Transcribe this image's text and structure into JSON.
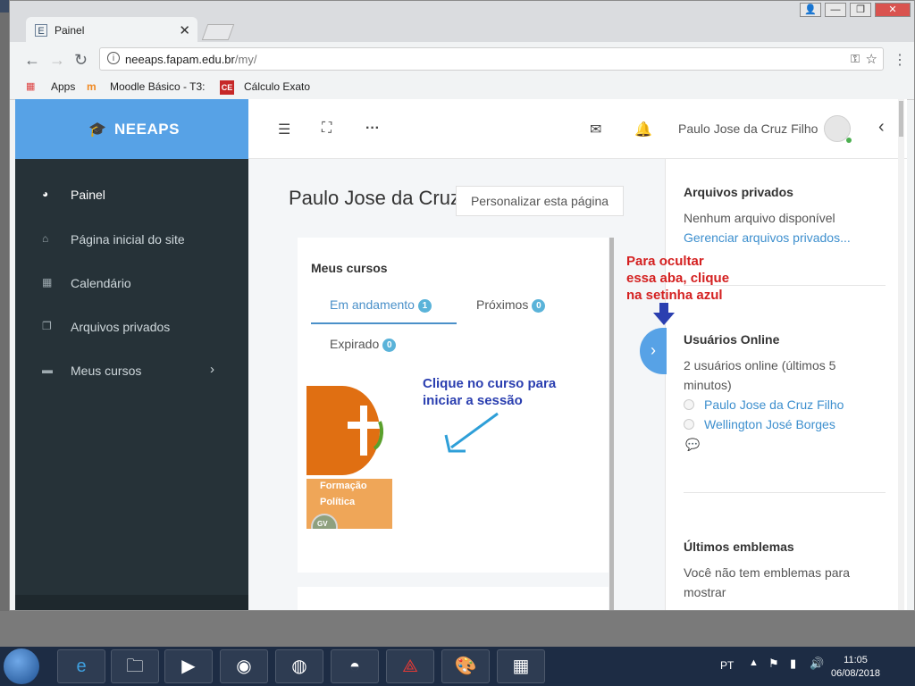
{
  "browser": {
    "tab_title": "Painel",
    "tab_favicon": "E",
    "url_host": "neeaps.fapam.edu.br",
    "url_path": "/my/",
    "bookmarks": [
      {
        "label": "Apps"
      },
      {
        "label": "Moodle Básico - T3:"
      },
      {
        "label": "Cálculo Exato"
      }
    ],
    "bookmark_ce_icon": "CE"
  },
  "site": {
    "brand": "NEEAPS",
    "sidebar": [
      {
        "label": "Painel",
        "icon": "dashboard-icon"
      },
      {
        "label": "Página inicial do site",
        "icon": "home-icon"
      },
      {
        "label": "Calendário",
        "icon": "calendar-icon"
      },
      {
        "label": "Arquivos privados",
        "icon": "files-icon"
      },
      {
        "label": "Meus cursos",
        "icon": "archive-icon"
      }
    ],
    "user_name": "Paulo Jose da Cruz Filho"
  },
  "main": {
    "page_title": "Paulo Jose da Cruz",
    "customize_button": "Personalizar esta página",
    "courses": {
      "title": "Meus cursos",
      "tabs": [
        {
          "label": "Em andamento",
          "count": "1"
        },
        {
          "label": "Próximos",
          "count": "0"
        },
        {
          "label": "Expirado",
          "count": "0"
        }
      ],
      "course_name_line1": "Formação",
      "course_name_line2": "Política",
      "course_badge": "GV"
    },
    "hint_course_line1": "Clique no curso para",
    "hint_course_line2": "iniciar a sessão",
    "hint_hide_line1": "Para ocultar",
    "hint_hide_line2": "essa aba, clique",
    "hint_hide_line3": "na setinha azul"
  },
  "drawer": {
    "private_files_title": "Arquivos privados",
    "private_files_empty": "Nenhum arquivo disponível",
    "private_files_link": "Gerenciar arquivos privados...",
    "online_title": "Usuários Online",
    "online_summary_line1": "2 usuários online (últimos 5",
    "online_summary_line2": "minutos)",
    "online_users": [
      "Paulo Jose da Cruz Filho",
      "Wellington José Borges"
    ],
    "badges_title": "Últimos emblemas",
    "badges_empty_line1": "Você não tem emblemas para",
    "badges_empty_line2": "mostrar"
  },
  "taskbar": {
    "lang": "PT",
    "time": "11:05",
    "date": "06/08/2018"
  },
  "colors": {
    "brand_blue": "#57a2e6",
    "sidebar_bg": "#263238",
    "hint_red": "#d42020",
    "hint_blue": "#2b3fb0"
  }
}
